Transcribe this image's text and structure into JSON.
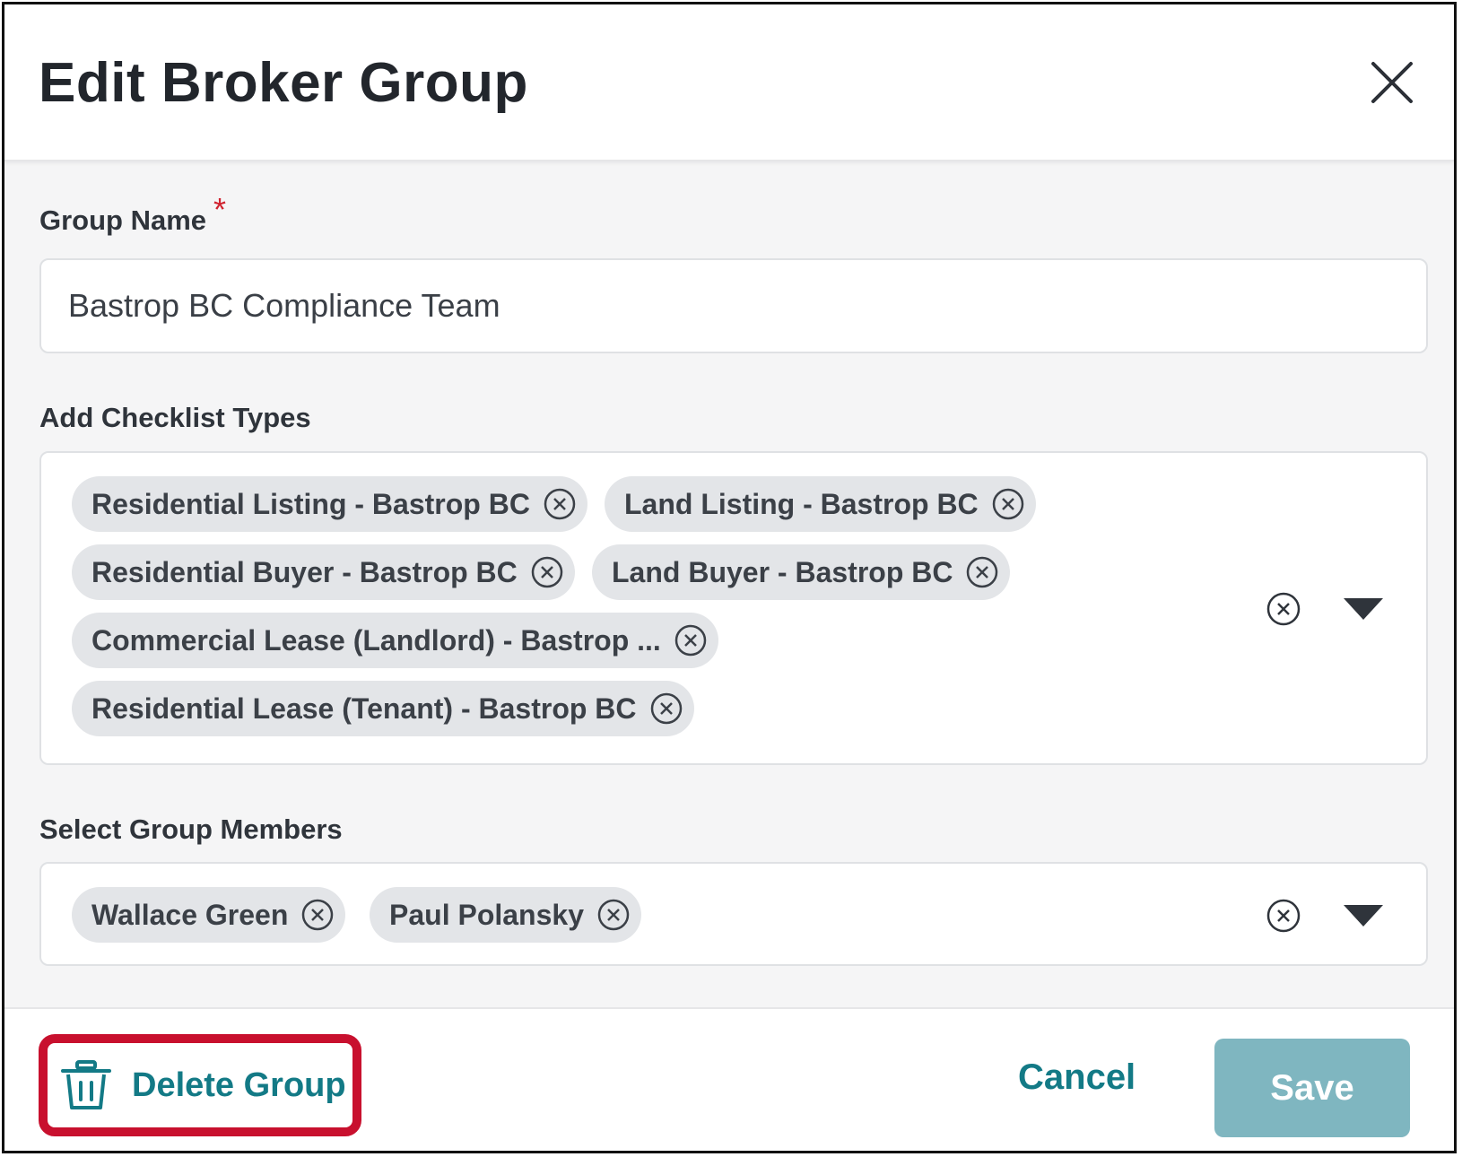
{
  "dialog": {
    "title": "Edit Broker Group",
    "close_icon": "close-icon"
  },
  "group_name": {
    "label": "Group Name",
    "required_marker": "*",
    "value": "Bastrop BC Compliance Team"
  },
  "checklist_types": {
    "label": "Add Checklist Types",
    "chips": [
      "Residential Listing - Bastrop BC",
      "Land Listing - Bastrop BC",
      "Residential Buyer - Bastrop BC",
      "Land Buyer - Bastrop BC",
      "Commercial Lease (Landlord) - Bastrop ...",
      "Residential Lease (Tenant) - Bastrop BC"
    ]
  },
  "group_members": {
    "label": "Select Group Members",
    "chips": [
      "Wallace Green",
      "Paul Polansky"
    ]
  },
  "footer": {
    "delete_label": "Delete Group",
    "cancel_label": "Cancel",
    "save_label": "Save"
  },
  "colors": {
    "accent": "#137a86",
    "save_disabled": "#7fb6c0",
    "required": "#d0222f",
    "highlight_box": "#c8102e",
    "chip_bg": "#e3e5e8"
  }
}
